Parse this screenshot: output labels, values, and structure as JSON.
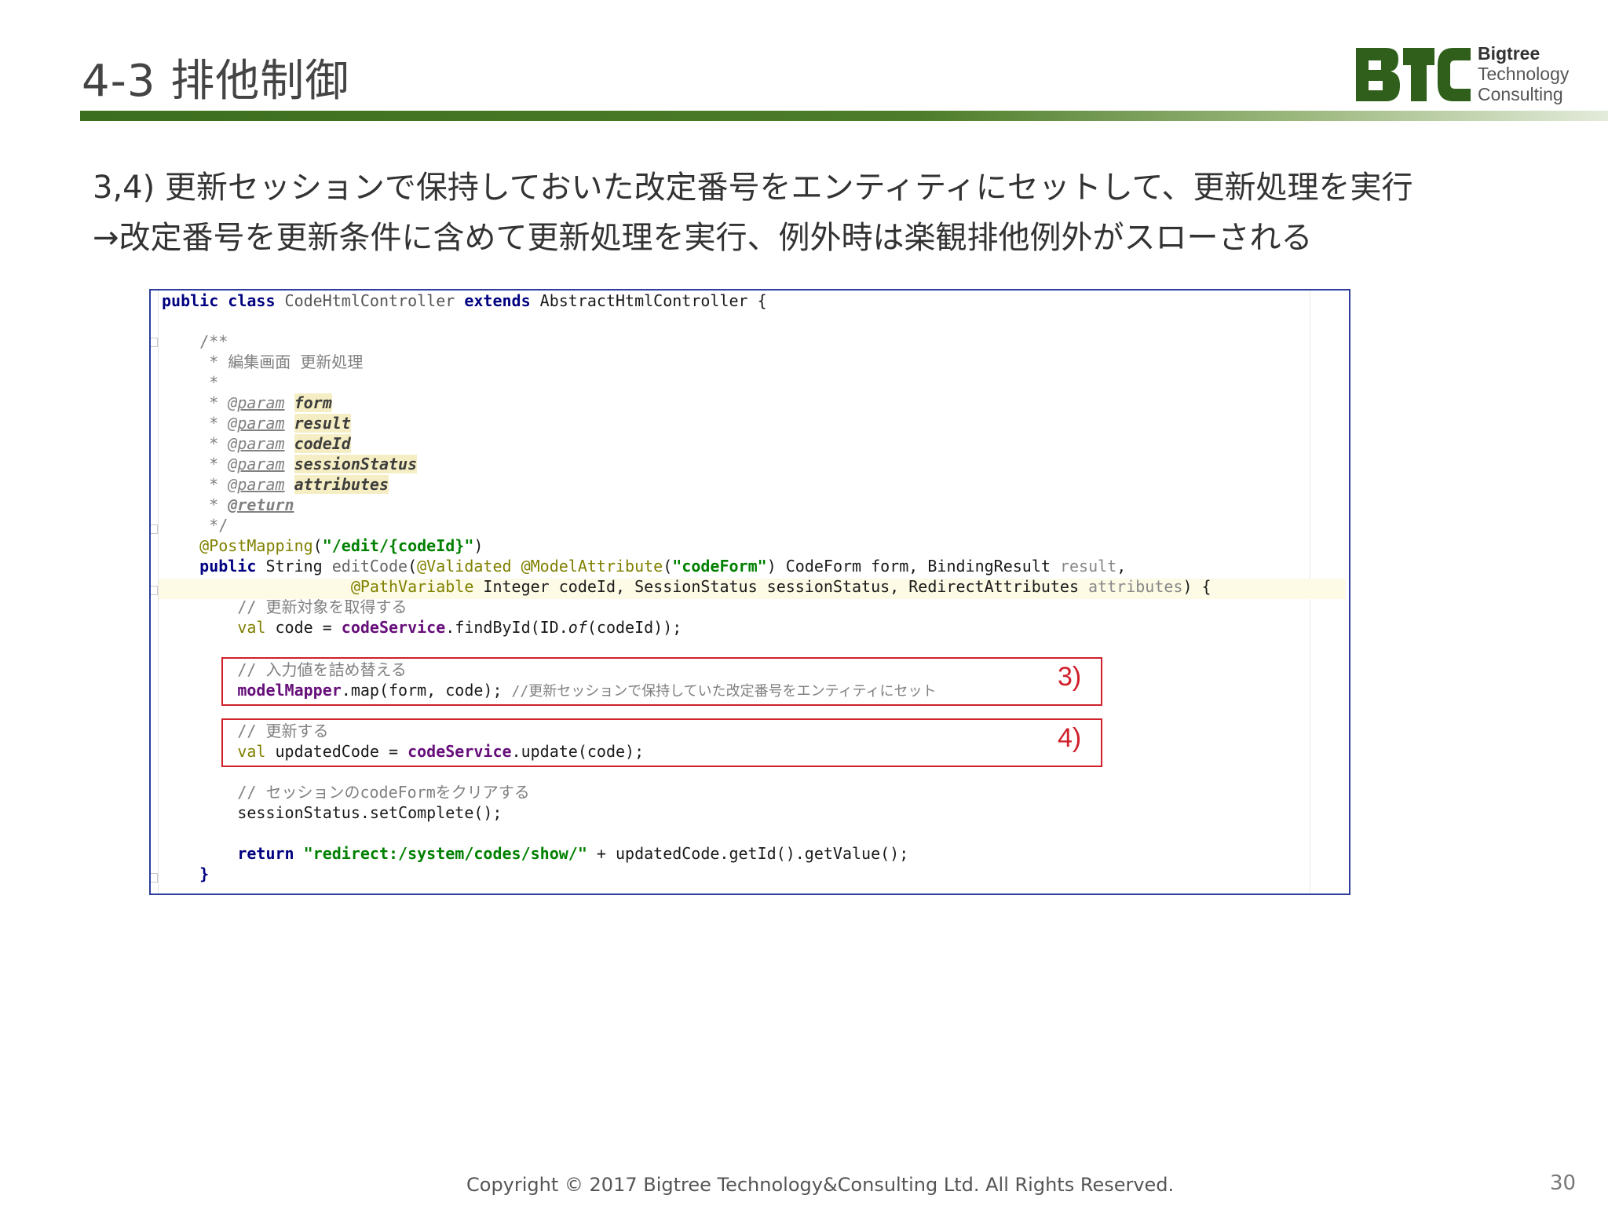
{
  "slide": {
    "title": "4-3 排他制御",
    "logo": {
      "line1": "Bigtree",
      "line2": "Technology",
      "line3": "Consulting",
      "mark": "BTC"
    },
    "subtitle_line1": "3,4) 更新セッションで保持しておいた改定番号をエンティティにセットして、更新処理を実行",
    "subtitle_line2": "→改定番号を更新条件に含めて更新処理を実行、例外時は楽観排他例外がスローされる",
    "footer": "Copyright © 2017 Bigtree Technology&Consulting Ltd. All Rights Reserved.",
    "page_number": "30"
  },
  "code": {
    "l01_kw1": "public class",
    "l01_name": " CodeHtmlController ",
    "l01_kw2": "extends",
    "l01_rest": " AbstractHtmlController {",
    "l03": "    /**",
    "l04": "     * 編集画面 更新処理",
    "l05": "     *",
    "l06_pre": "     * ",
    "l06_tag": "@param",
    "l06_name": "form",
    "l07_pre": "     * ",
    "l07_tag": "@param",
    "l07_name": "result",
    "l08_pre": "     * ",
    "l08_tag": "@param",
    "l08_name": "codeId",
    "l09_pre": "     * ",
    "l09_tag": "@param",
    "l09_name": "sessionStatus",
    "l10_pre": "     * ",
    "l10_tag": "@param",
    "l10_name": "attributes",
    "l11_pre": "     * ",
    "l11_tag": "@return",
    "l12": "     */",
    "l13_ann": "    @PostMapping",
    "l13_p1": "(",
    "l13_str": "\"/edit/{codeId}\"",
    "l13_p2": ")",
    "l14_kw": "    public",
    "l14_a": " String ",
    "l14_m": "editCode",
    "l14_b": "(",
    "l14_ann1": "@Validated",
    "l14_sp": " ",
    "l14_ann2": "@ModelAttribute",
    "l14_c": "(",
    "l14_str": "\"codeForm\"",
    "l14_d": ") CodeForm form, BindingResult ",
    "l14_e": "result",
    "l14_f": ",",
    "l15_pad": "                    ",
    "l15_ann": "@PathVariable",
    "l15_a": " Integer codeId, SessionStatus sessionStatus, RedirectAttributes ",
    "l15_b": "attributes",
    "l15_c": ") {",
    "l16": "        // 更新対象を取得する",
    "l17_a": "        val",
    "l17_b": " code = ",
    "l17_f": "codeService",
    "l17_c": ".findById(ID.",
    "l17_i": "of",
    "l17_d": "(codeId));",
    "l19": "        // 入力値を詰め替える",
    "l20_pad": "        ",
    "l20_f": "modelMapper",
    "l20_a": ".map(form, code); ",
    "l20_cm": "//更新セッションで保持していた改定番号をエンティティにセット",
    "l22": "        // 更新する",
    "l23_a": "        val",
    "l23_b": " updatedCode = ",
    "l23_f": "codeService",
    "l23_c": ".update(code);",
    "l25": "        // セッションのcodeFormをクリアする",
    "l26": "        sessionStatus.setComplete();",
    "l28_kw": "        return",
    "l28_sp": " ",
    "l28_str": "\"redirect:/system/codes/show/\"",
    "l28_rest": " + updatedCode.getId().getValue();",
    "l29": "    }"
  },
  "markers": {
    "m3": "3)",
    "m4": "4)"
  }
}
